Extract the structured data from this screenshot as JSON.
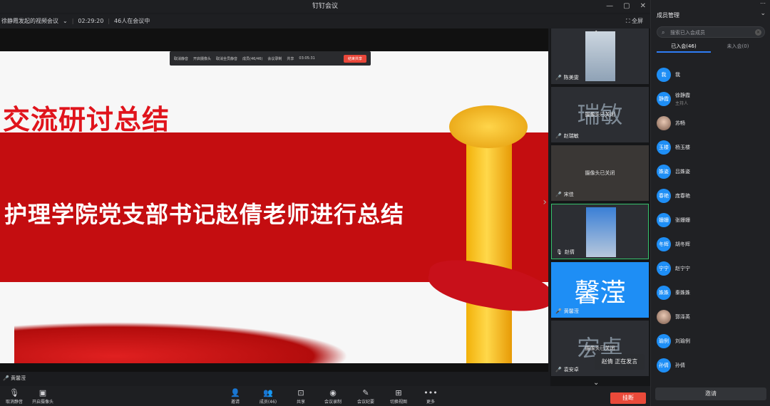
{
  "window": {
    "title": "钉钉会议",
    "minimize": "—",
    "maximize": "▢",
    "close": "✕"
  },
  "info": {
    "meeting_name": "徐静霞发起的视频会议",
    "chevron": "⌄",
    "elapsed": "02:29:20",
    "online": "46人在会议中",
    "fullscreen": "全屏"
  },
  "slide": {
    "title": "交流研讨总结",
    "subtitle": "护理学院党支部书记赵倩老师进行总结"
  },
  "float_bar": {
    "items": [
      "取消静音",
      "开启摄像头",
      "取消全员静音",
      "成员(46/46)",
      "会议录制",
      "共享"
    ],
    "timer": "03:05:31",
    "end": "结束共享"
  },
  "stage": {
    "speaker_label": "黄馨滢"
  },
  "thumbs": [
    {
      "name": "陈美雯",
      "big": "",
      "camoff": ""
    },
    {
      "name": "赵瑞敏",
      "big": "瑞敏",
      "camoff": "摄像头已关闭"
    },
    {
      "name": "宋佳",
      "big": "",
      "camoff": "摄像头已关闭"
    },
    {
      "name": "赵倩",
      "big": "",
      "camoff": ""
    },
    {
      "name": "黄馨滢",
      "big": "馨滢",
      "camoff": ""
    },
    {
      "name": "袁安卓",
      "big": "宏卓",
      "camoff": "摄像头已关闭"
    }
  ],
  "toast": {
    "text": "赵倩  正在发言"
  },
  "toolbar": {
    "mute": "取消静音",
    "camera": "开启摄像头",
    "invite": "邀请",
    "members": "成员(46)",
    "share": "共享",
    "record": "会议录制",
    "minutes": "会议纪要",
    "layout": "切换视图",
    "more": "更多",
    "leave": "挂断"
  },
  "panel": {
    "title": "成员管理",
    "search_placeholder": "搜索已入会成员",
    "tab_joined": "已入会(46)",
    "tab_not_joined": "未入会(0)",
    "invite": "邀请",
    "members": [
      {
        "avatar": "我",
        "name": "我",
        "role": ""
      },
      {
        "avatar": "静霞",
        "name": "徐静霞",
        "role": "主持人"
      },
      {
        "avatar": "",
        "name": "苏畅",
        "role": ""
      },
      {
        "avatar": "玉楼",
        "name": "杨玉楼",
        "role": ""
      },
      {
        "avatar": "姝姿",
        "name": "吕姝姿",
        "role": ""
      },
      {
        "avatar": "春艳",
        "name": "庞春艳",
        "role": ""
      },
      {
        "avatar": "姗姗",
        "name": "张姗姗",
        "role": ""
      },
      {
        "avatar": "冬辉",
        "name": "胡冬辉",
        "role": ""
      },
      {
        "avatar": "宁宁",
        "name": "赵宁宁",
        "role": ""
      },
      {
        "avatar": "姝姝",
        "name": "秦姝姝",
        "role": ""
      },
      {
        "avatar": "",
        "name": "郭泽英",
        "role": ""
      },
      {
        "avatar": "瑜例",
        "name": "刘瑜例",
        "role": ""
      },
      {
        "avatar": "孙倩",
        "name": "孙倩",
        "role": ""
      }
    ]
  },
  "colors": {
    "accent": "#1e8ef5",
    "leave": "#ea4a3a",
    "slide_red": "#c40d10"
  }
}
